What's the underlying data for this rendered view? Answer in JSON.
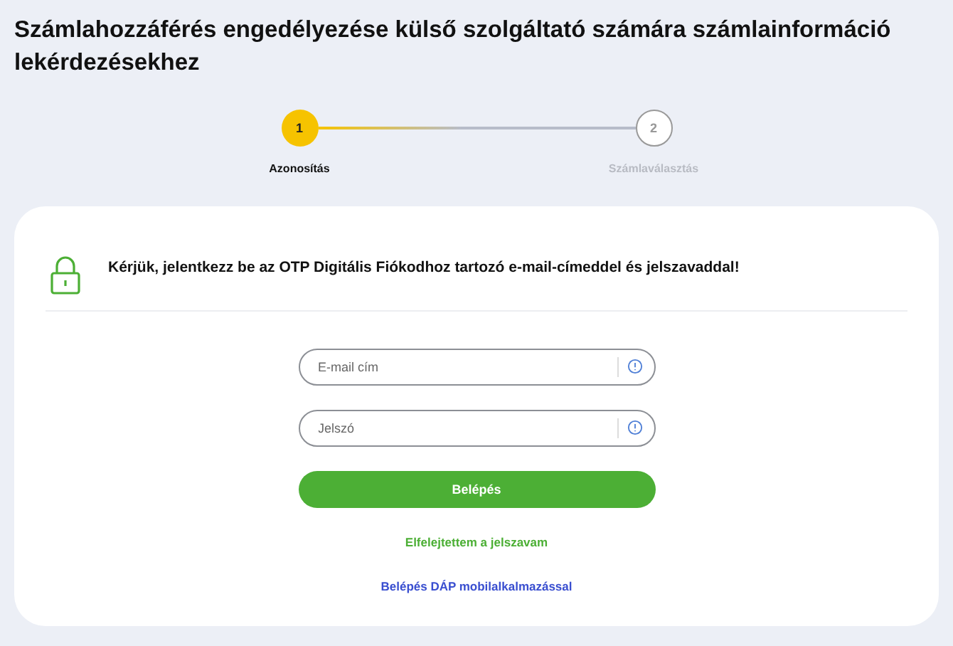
{
  "title": "Számlahozzáférés engedélyezése külső szolgáltató számára számlainformáció lekérdezésekhez",
  "steps": [
    {
      "number": "1",
      "label": "Azonosítás",
      "active": true
    },
    {
      "number": "2",
      "label": "Számlaválasztás",
      "active": false
    }
  ],
  "card": {
    "message": "Kérjük, jelentkezz be az OTP Digitális Fiókodhoz tartozó e-mail-címeddel és jelszavaddal!",
    "fields": [
      {
        "placeholder": "E-mail cím"
      },
      {
        "placeholder": "Jelszó"
      }
    ],
    "submit": "Belépés",
    "links": [
      {
        "label": "Elfelejtettem a jelszavam",
        "color": "#4caf35"
      },
      {
        "label": "Belépés DÁP mobilalkalmazással",
        "color": "#3a4fd0"
      }
    ]
  }
}
